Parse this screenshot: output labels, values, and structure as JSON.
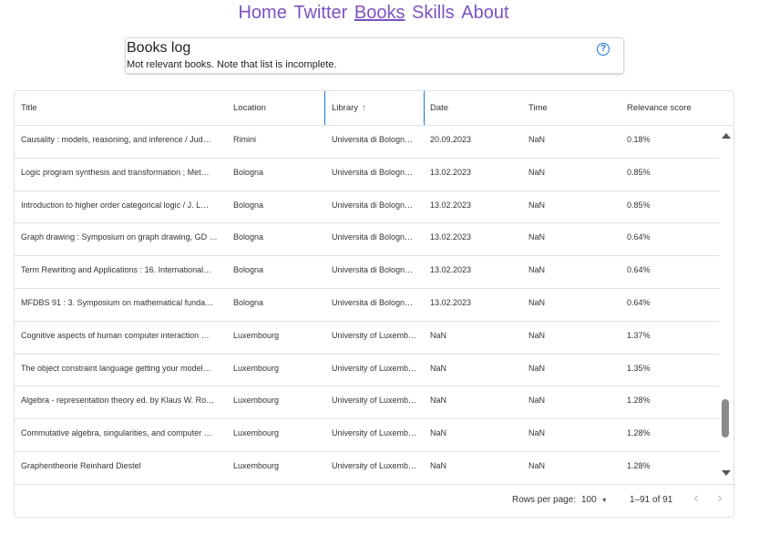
{
  "nav": {
    "items": [
      {
        "label": "Home"
      },
      {
        "label": "Twitter"
      },
      {
        "label": "Books",
        "active": true
      },
      {
        "label": "Skills"
      },
      {
        "label": "About"
      }
    ]
  },
  "card": {
    "title": "Books log",
    "subtitle": "Mot relevant books. Note that list is incomplete.",
    "help_icon": "help-circle-icon",
    "help_glyph": "?"
  },
  "table": {
    "columns": [
      {
        "label": "Title"
      },
      {
        "label": "Location"
      },
      {
        "label": "Library",
        "sort_glyph": "↑",
        "sort": "ascending"
      },
      {
        "label": "Date"
      },
      {
        "label": "Time"
      },
      {
        "label": "Relevance score"
      }
    ],
    "rows": [
      [
        "Causality : models, reasoning, and inference / Jud…",
        "Rimini",
        "Universita di Bologn…",
        "20.09.2023",
        "NaN",
        "0.18%"
      ],
      [
        "Logic program synthesis and transformation ; Met…",
        "Bologna",
        "Universita di Bologn…",
        "13.02.2023",
        "NaN",
        "0.85%"
      ],
      [
        "Introduction to higher order categorical logic / J. L…",
        "Bologna",
        "Universita di Bologn…",
        "13.02.2023",
        "NaN",
        "0.85%"
      ],
      [
        "Graph drawing : Symposium on graph drawing, GD …",
        "Bologna",
        "Universita di Bologn…",
        "13.02.2023",
        "NaN",
        "0.64%"
      ],
      [
        "Term Rewriting and Applications : 16. International…",
        "Bologna",
        "Universita di Bologn…",
        "13.02.2023",
        "NaN",
        "0.64%"
      ],
      [
        "MFDBS 91 : 3. Symposium on mathematical funda…",
        "Bologna",
        "Universita di Bologn…",
        "13.02.2023",
        "NaN",
        "0.64%"
      ],
      [
        "Cognitive aspects of human computer interaction …",
        "Luxembourg",
        "University of Luxemb…",
        "NaN",
        "NaN",
        "1.37%"
      ],
      [
        "The object constraint language getting your model…",
        "Luxembourg",
        "University of Luxemb…",
        "NaN",
        "NaN",
        "1.35%"
      ],
      [
        "Algebra - representation theory ed. by Klaus W. Ro…",
        "Luxembourg",
        "University of Luxemb…",
        "NaN",
        "NaN",
        "1.28%"
      ],
      [
        "Commutative algebra, singularities, and computer …",
        "Luxembourg",
        "University of Luxemb…",
        "NaN",
        "NaN",
        "1.28%"
      ],
      [
        "Graphentheorie Reinhard Diestel",
        "Luxembourg",
        "University of Luxemb…",
        "NaN",
        "NaN",
        "1.28%"
      ]
    ]
  },
  "footer": {
    "rows_per_page_label": "Rows per page:",
    "rows_per_page_value": "100",
    "range_text": "1–91 of 91",
    "prev_glyph": "‹",
    "next_glyph": "›"
  },
  "colors": {
    "nav_link": "#7b52c4",
    "accent": "#1976d2"
  }
}
